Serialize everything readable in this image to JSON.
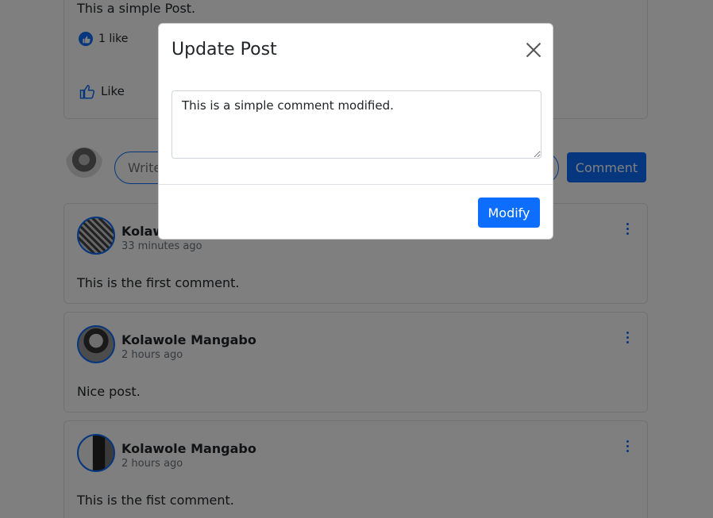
{
  "post": {
    "text": "This a simple Post.",
    "likes_count": "1 like",
    "like_label": "Like"
  },
  "composer": {
    "placeholder": "Write a comment...",
    "button_label": "Comment"
  },
  "comments": [
    {
      "author": "Kolawole Mangabo",
      "time": "33 minutes ago",
      "text": "This is the first comment."
    },
    {
      "author": "Kolawole Mangabo",
      "time": "2 hours ago",
      "text": "Nice post."
    },
    {
      "author": "Kolawole Mangabo",
      "time": "2 hours ago",
      "text": "This is the fist comment."
    }
  ],
  "modal": {
    "title": "Update Post",
    "textarea_value": "This is a simple comment modified.",
    "submit_label": "Modify"
  },
  "colors": {
    "primary": "#0d6efd",
    "overlay": "rgba(0,0,0,0.5)"
  }
}
